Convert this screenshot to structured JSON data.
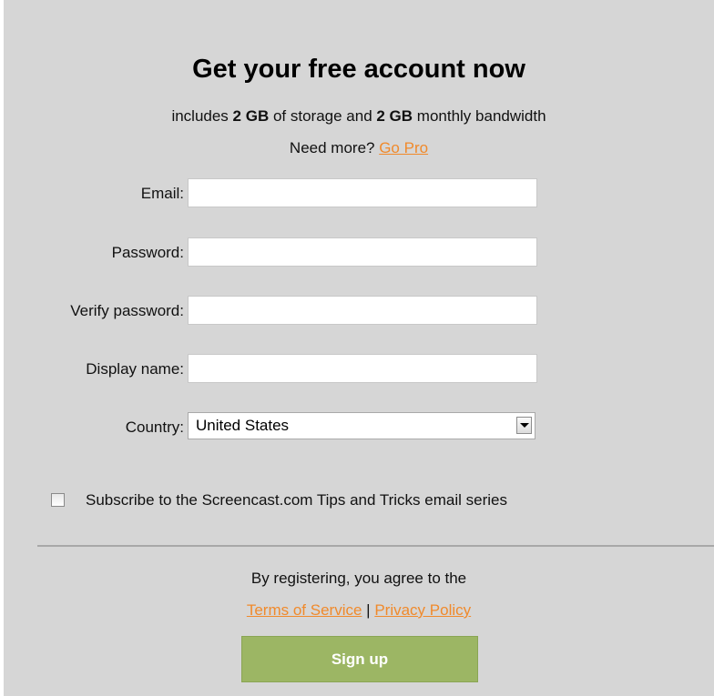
{
  "header": {
    "title": "Get your free account now",
    "subtitle_prefix": "includes ",
    "storage_amount": "2 GB",
    "subtitle_middle": " of storage and ",
    "bandwidth_amount": "2 GB",
    "subtitle_suffix": " monthly bandwidth",
    "need_more": "Need more? ",
    "go_pro_link": "Go Pro"
  },
  "form": {
    "email": {
      "label": "Email:",
      "value": "",
      "placeholder": ""
    },
    "password": {
      "label": "Password:",
      "value": "",
      "placeholder": ""
    },
    "verify_password": {
      "label": "Verify password:",
      "value": "",
      "placeholder": ""
    },
    "display_name": {
      "label": "Display name:",
      "value": "",
      "placeholder": ""
    },
    "country": {
      "label": "Country:",
      "selected": "United States"
    },
    "subscribe": {
      "label": "Subscribe to the Screencast.com Tips and Tricks email series",
      "checked": false
    }
  },
  "footer": {
    "agree_text": "By registering, you agree to the",
    "terms_link": "Terms of Service",
    "separator": "|",
    "privacy_link": "Privacy Policy",
    "signup_label": "Sign up"
  },
  "colors": {
    "panel_background": "#d6d6d6",
    "link": "#f08a2c",
    "signup_button": "#9cb664",
    "divider": "#a8a8a8"
  },
  "icons": {
    "country_dropdown": "chevron-down-icon"
  }
}
